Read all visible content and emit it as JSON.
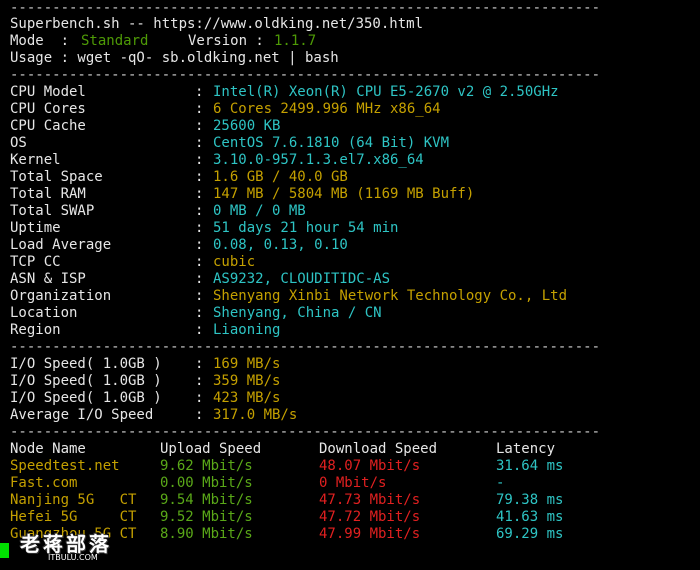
{
  "separator": "----------------------------------------------------------------------",
  "header": {
    "line1": "Superbench.sh -- https://www.oldking.net/350.html",
    "mode_label": "Mode  : ",
    "mode_value": "Standard",
    "version_label": "Version : ",
    "version_value": "1.1.7",
    "usage": "Usage : wget -qO- sb.oldking.net | bash"
  },
  "system": [
    {
      "label": "CPU Model",
      "value": "Intel(R) Xeon(R) CPU E5-2670 v2 @ 2.50GHz",
      "color": "cyan"
    },
    {
      "label": "CPU Cores",
      "value": "6 Cores 2499.996 MHz x86_64",
      "color": "yellow"
    },
    {
      "label": "CPU Cache",
      "value": "25600 KB",
      "color": "cyan"
    },
    {
      "label": "OS",
      "value": "CentOS 7.6.1810 (64 Bit) KVM",
      "color": "cyan"
    },
    {
      "label": "Kernel",
      "value": "3.10.0-957.1.3.el7.x86_64",
      "color": "cyan"
    },
    {
      "label": "Total Space",
      "value": "1.6 GB / 40.0 GB",
      "color": "yellow"
    },
    {
      "label": "Total RAM",
      "value": "147 MB / 5804 MB (1169 MB Buff)",
      "color": "yellow"
    },
    {
      "label": "Total SWAP",
      "value": "0 MB / 0 MB",
      "color": "cyan"
    },
    {
      "label": "Uptime",
      "value": "51 days 21 hour 54 min",
      "color": "cyan"
    },
    {
      "label": "Load Average",
      "value": "0.08, 0.13, 0.10",
      "color": "cyan"
    },
    {
      "label": "TCP CC",
      "value": "cubic",
      "color": "yellow"
    },
    {
      "label": "ASN & ISP",
      "value": "AS9232, CLOUDITIDC-AS",
      "color": "cyan"
    },
    {
      "label": "Organization",
      "value": "Shenyang Xinbi Network Technology Co., Ltd",
      "color": "yellow"
    },
    {
      "label": "Location",
      "value": "Shenyang, China / CN",
      "color": "cyan"
    },
    {
      "label": "Region",
      "value": "Liaoning",
      "color": "cyan"
    }
  ],
  "io": [
    {
      "label": "I/O Speed( 1.0GB )",
      "value": "169 MB/s"
    },
    {
      "label": "I/O Speed( 1.0GB )",
      "value": "359 MB/s"
    },
    {
      "label": "I/O Speed( 1.0GB )",
      "value": "423 MB/s"
    },
    {
      "label": "Average I/O Speed",
      "value": "317.0 MB/s"
    }
  ],
  "speedtest": {
    "headers": [
      "Node Name",
      "Upload Speed",
      "Download Speed",
      "Latency"
    ],
    "rows": [
      {
        "node": "Speedtest.net",
        "upload": "9.62 Mbit/s",
        "download": "48.07 Mbit/s",
        "latency": "31.64 ms"
      },
      {
        "node": "Fast.com",
        "upload": "0.00 Mbit/s",
        "download": "0 Mbit/s",
        "latency": "-"
      },
      {
        "node": "Nanjing 5G   CT",
        "upload": "9.54 Mbit/s",
        "download": "47.73 Mbit/s",
        "latency": "79.38 ms"
      },
      {
        "node": "Hefei 5G     CT",
        "upload": "9.52 Mbit/s",
        "download": "47.72 Mbit/s",
        "latency": "41.63 ms"
      },
      {
        "node": "Guangzhou 5G CT",
        "upload": "8.90 Mbit/s",
        "download": "47.99 Mbit/s",
        "latency": "69.29 ms"
      }
    ]
  },
  "watermark": {
    "title": "老蒋部落",
    "subtitle": "ITBULU.COM"
  },
  "colors": {
    "cyan": "#2ec4c4",
    "yellow": "#c4a000",
    "green": "#4e9a06",
    "red": "#e02020",
    "cursor": "#00e000"
  }
}
